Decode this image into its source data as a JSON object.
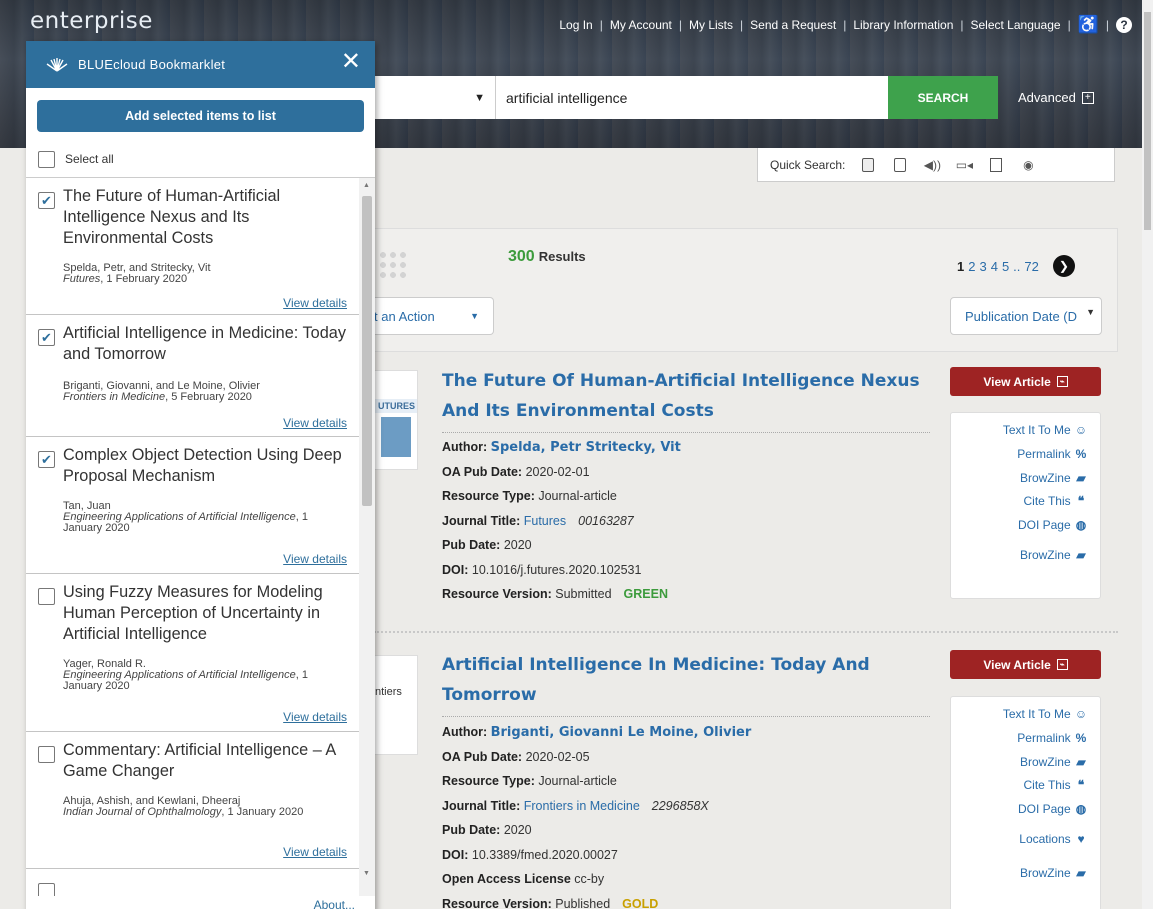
{
  "header": {
    "logo": "enterprise",
    "nav": [
      "Log In",
      "My Account",
      "My Lists",
      "Send a Request",
      "Library Information",
      "Select Language"
    ],
    "search_value": "artificial intelligence",
    "search_button": "SEARCH",
    "advanced": "Advanced"
  },
  "quick_search": {
    "label": "Quick Search:",
    "icons": [
      "pdf-icon",
      "ebook-icon",
      "audio-icon",
      "video-icon",
      "map-icon",
      "disc-icon"
    ]
  },
  "results": {
    "count": "300",
    "count_label": "Results",
    "pages": [
      "1",
      "2",
      "3",
      "4",
      "5",
      "..",
      "72"
    ],
    "action_select": "t an Action",
    "sort_select": "Publication Date (D"
  },
  "result_items": [
    {
      "title": "The Future Of Human-Artificial Intelligence Nexus And Its Environmental Costs",
      "thumb_text": "UTURES",
      "author": "Spelda, Petr Stritecky, Vit",
      "oa_pub_date": "2020-02-01",
      "resource_type": "Journal-article",
      "journal_title": "Futures",
      "issn": "00163287",
      "pub_date": "2020",
      "doi": "10.1016/j.futures.2020.102531",
      "resource_version": "Submitted",
      "oa_color": "GREEN",
      "view_article": "View Article",
      "links": [
        "Text It To Me",
        "Permalink",
        "BrowZine",
        "Cite This",
        "DOI Page",
        "BrowZine"
      ]
    },
    {
      "title": "Artificial Intelligence In Medicine: Today And Tomorrow",
      "thumb_text": "ntiers",
      "author": "Briganti, Giovanni Le Moine, Olivier",
      "oa_pub_date": "2020-02-05",
      "resource_type": "Journal-article",
      "journal_title": "Frontiers in Medicine",
      "issn": "2296858X",
      "pub_date": "2020",
      "doi": "10.3389/fmed.2020.00027",
      "license": "cc-by",
      "resource_version": "Published",
      "oa_color": "GOLD",
      "view_article": "View Article",
      "links": [
        "Text It To Me",
        "Permalink",
        "BrowZine",
        "Cite This",
        "DOI Page",
        "Locations",
        "BrowZine"
      ]
    }
  ],
  "labels": {
    "author": "Author:",
    "oa_pub_date": "OA Pub Date:",
    "resource_type": "Resource Type:",
    "journal_title": "Journal Title:",
    "pub_date": "Pub Date:",
    "doi": "DOI:",
    "resource_version": "Resource Version:",
    "license": "Open Access License"
  },
  "bookmarklet": {
    "title": "BLUEcloud Bookmarklet",
    "add_button": "Add selected items to list",
    "select_all": "Select all",
    "view_details": "View details",
    "about": "About...",
    "items": [
      {
        "title": "The Future of Human-Artificial Intelligence Nexus and Its Environmental Costs",
        "author": "Spelda, Petr, and Stritecky, Vit",
        "source": "Futures",
        "date": ", 1 February 2020",
        "checked": true
      },
      {
        "title": "Artificial Intelligence in Medicine: Today and Tomorrow",
        "author": "Briganti, Giovanni, and Le Moine, Olivier",
        "source": "Frontiers in Medicine",
        "date": ", 5 February 2020",
        "checked": true
      },
      {
        "title": "Complex Object Detection Using Deep Proposal Mechanism",
        "author": "Tan, Juan",
        "source": "Engineering Applications of Artificial Intelligence",
        "date": ", 1 January 2020",
        "checked": true
      },
      {
        "title": "Using Fuzzy Measures for Modeling Human Perception of Uncertainty in Artificial Intelligence",
        "author": "Yager, Ronald R.",
        "source": "Engineering Applications of Artificial Intelligence",
        "date": ", 1 January 2020",
        "checked": false
      },
      {
        "title": "Commentary: Artificial Intelligence – A Game Changer",
        "author": "Ahuja, Ashish, and Kewlani, Dheeraj",
        "source": "Indian Journal of Ophthalmology",
        "date": ", 1 January 2020",
        "checked": false
      }
    ]
  },
  "colors": {
    "brand_blue": "#2e6f9c",
    "link_blue": "#2a6ca8",
    "search_green": "#3ea24c",
    "view_article_red": "#9e2323",
    "green_text": "#3c9b3c",
    "gold_text": "#c8a000"
  }
}
